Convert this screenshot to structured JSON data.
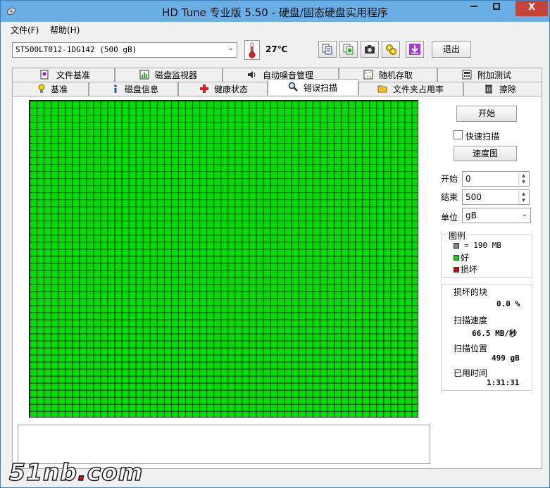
{
  "window": {
    "title": "HD Tune 专业版 5.50 - 硬盘/固态硬盘实用程序",
    "close_label": "X"
  },
  "menu": [
    {
      "label": "文件(F)"
    },
    {
      "label": "帮助(H)"
    }
  ],
  "toolbar": {
    "drive": "ST500LT012-1DG142 (500 gB)",
    "temperature": "27℃",
    "exit_label": "退出",
    "icons": [
      "copy-info-icon",
      "copy-screen-icon",
      "camera-icon",
      "options-icon",
      "download-icon"
    ]
  },
  "tabs": {
    "row1": [
      {
        "label": "文件基准",
        "icon": "file-benchmark-icon"
      },
      {
        "label": "磁盘监视器",
        "icon": "disk-monitor-icon"
      },
      {
        "label": "自动噪音管理",
        "icon": "speaker-icon"
      },
      {
        "label": "随机存取",
        "icon": "random-access-icon"
      },
      {
        "label": "附加测试",
        "icon": "extra-tests-icon"
      }
    ],
    "row2": [
      {
        "label": "基准",
        "icon": "benchmark-icon"
      },
      {
        "label": "磁盘信息",
        "icon": "info-icon"
      },
      {
        "label": "健康状态",
        "icon": "health-icon"
      },
      {
        "label": "错误扫描",
        "icon": "magnifier-icon",
        "active": true
      },
      {
        "label": "文件夹占用率",
        "icon": "folder-icon"
      },
      {
        "label": "擦除",
        "icon": "trash-icon"
      }
    ]
  },
  "scan": {
    "start_button": "开始",
    "quick_scan_label": "快速扫描",
    "quick_scan_checked": false,
    "speed_map_button": "速度图",
    "start_label": "开始",
    "start_value": "0",
    "end_label": "结束",
    "end_value": "500",
    "unit_label": "单位",
    "unit_value": "gB",
    "block_state": "good",
    "status_colors": {
      "good": "#00e000",
      "damaged": "#e00000",
      "block_size": "#808080"
    }
  },
  "legend": {
    "title": "图例",
    "block_size": "= 190 MB",
    "good": "好",
    "damaged": "损坏"
  },
  "stats": {
    "damaged_blocks_label": "损坏的块",
    "damaged_blocks_value": "0.0 %",
    "scan_speed_label": "扫描速度",
    "scan_speed_value": "66.5 MB/秒",
    "scan_position_label": "扫描位置",
    "scan_position_value": "499 gB",
    "elapsed_label": "已用时间",
    "elapsed_value": "1:31:31"
  },
  "watermark": {
    "text_a": "51nb",
    "dot": ".",
    "text_b": "com"
  }
}
